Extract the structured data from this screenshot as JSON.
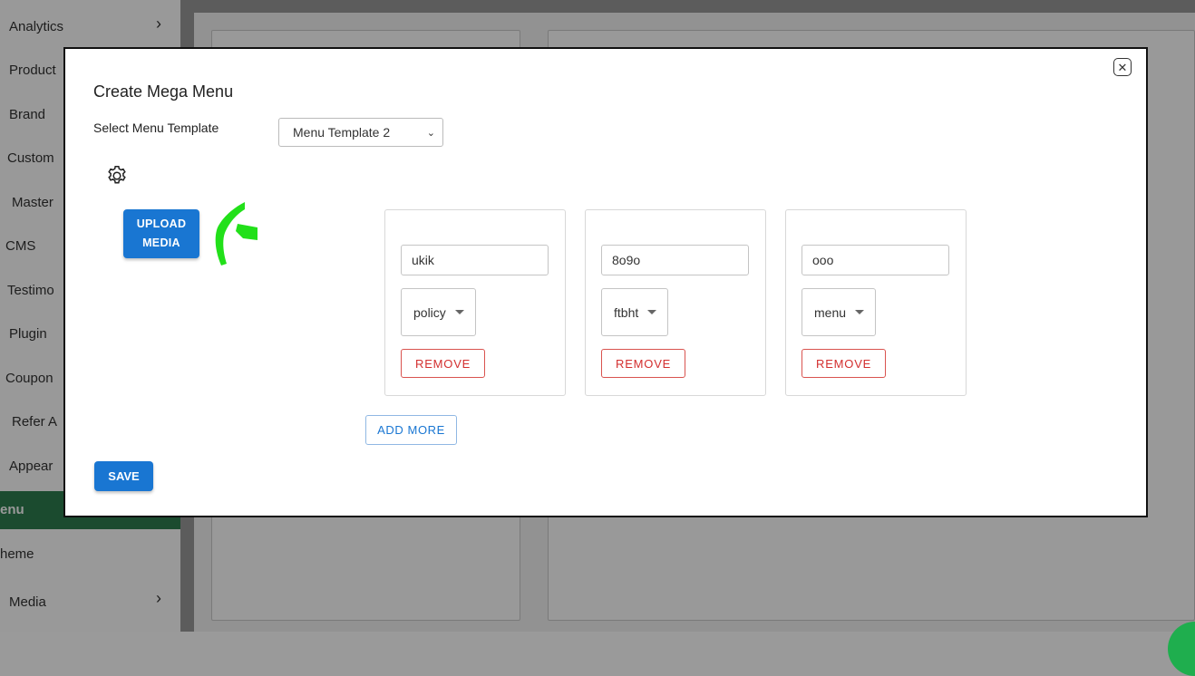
{
  "sidebar": {
    "items": [
      {
        "label": "Analytics"
      },
      {
        "label": "Product"
      },
      {
        "label": "Brand"
      },
      {
        "label": "Custom"
      },
      {
        "label": "Master"
      },
      {
        "label": "CMS"
      },
      {
        "label": "Testimo"
      },
      {
        "label": "Plugin"
      },
      {
        "label": "Coupon"
      },
      {
        "label": "Refer A"
      },
      {
        "label": "Appear"
      },
      {
        "label": "enu"
      },
      {
        "label": "heme"
      },
      {
        "label": "Media"
      }
    ]
  },
  "modal": {
    "title": "Create Mega Menu",
    "close_icon": "close-icon",
    "template_label": "Select Menu Template",
    "template_value": "Menu Template 2",
    "upload_label_line1": "UPLOAD",
    "upload_label_line2": "MEDIA",
    "items": [
      {
        "text": "ukik",
        "select": "policy",
        "remove": "REMOVE"
      },
      {
        "text": "8o9o",
        "select": "ftbht",
        "remove": "REMOVE"
      },
      {
        "text": "ooo",
        "select": "menu",
        "remove": "REMOVE"
      }
    ],
    "add_more_label": "ADD MORE",
    "save_label": "SAVE"
  },
  "colors": {
    "primary": "#1976d2",
    "danger": "#d32f2f",
    "sidebar_active": "#2e7d4f",
    "logo_green": "#22e01a"
  }
}
